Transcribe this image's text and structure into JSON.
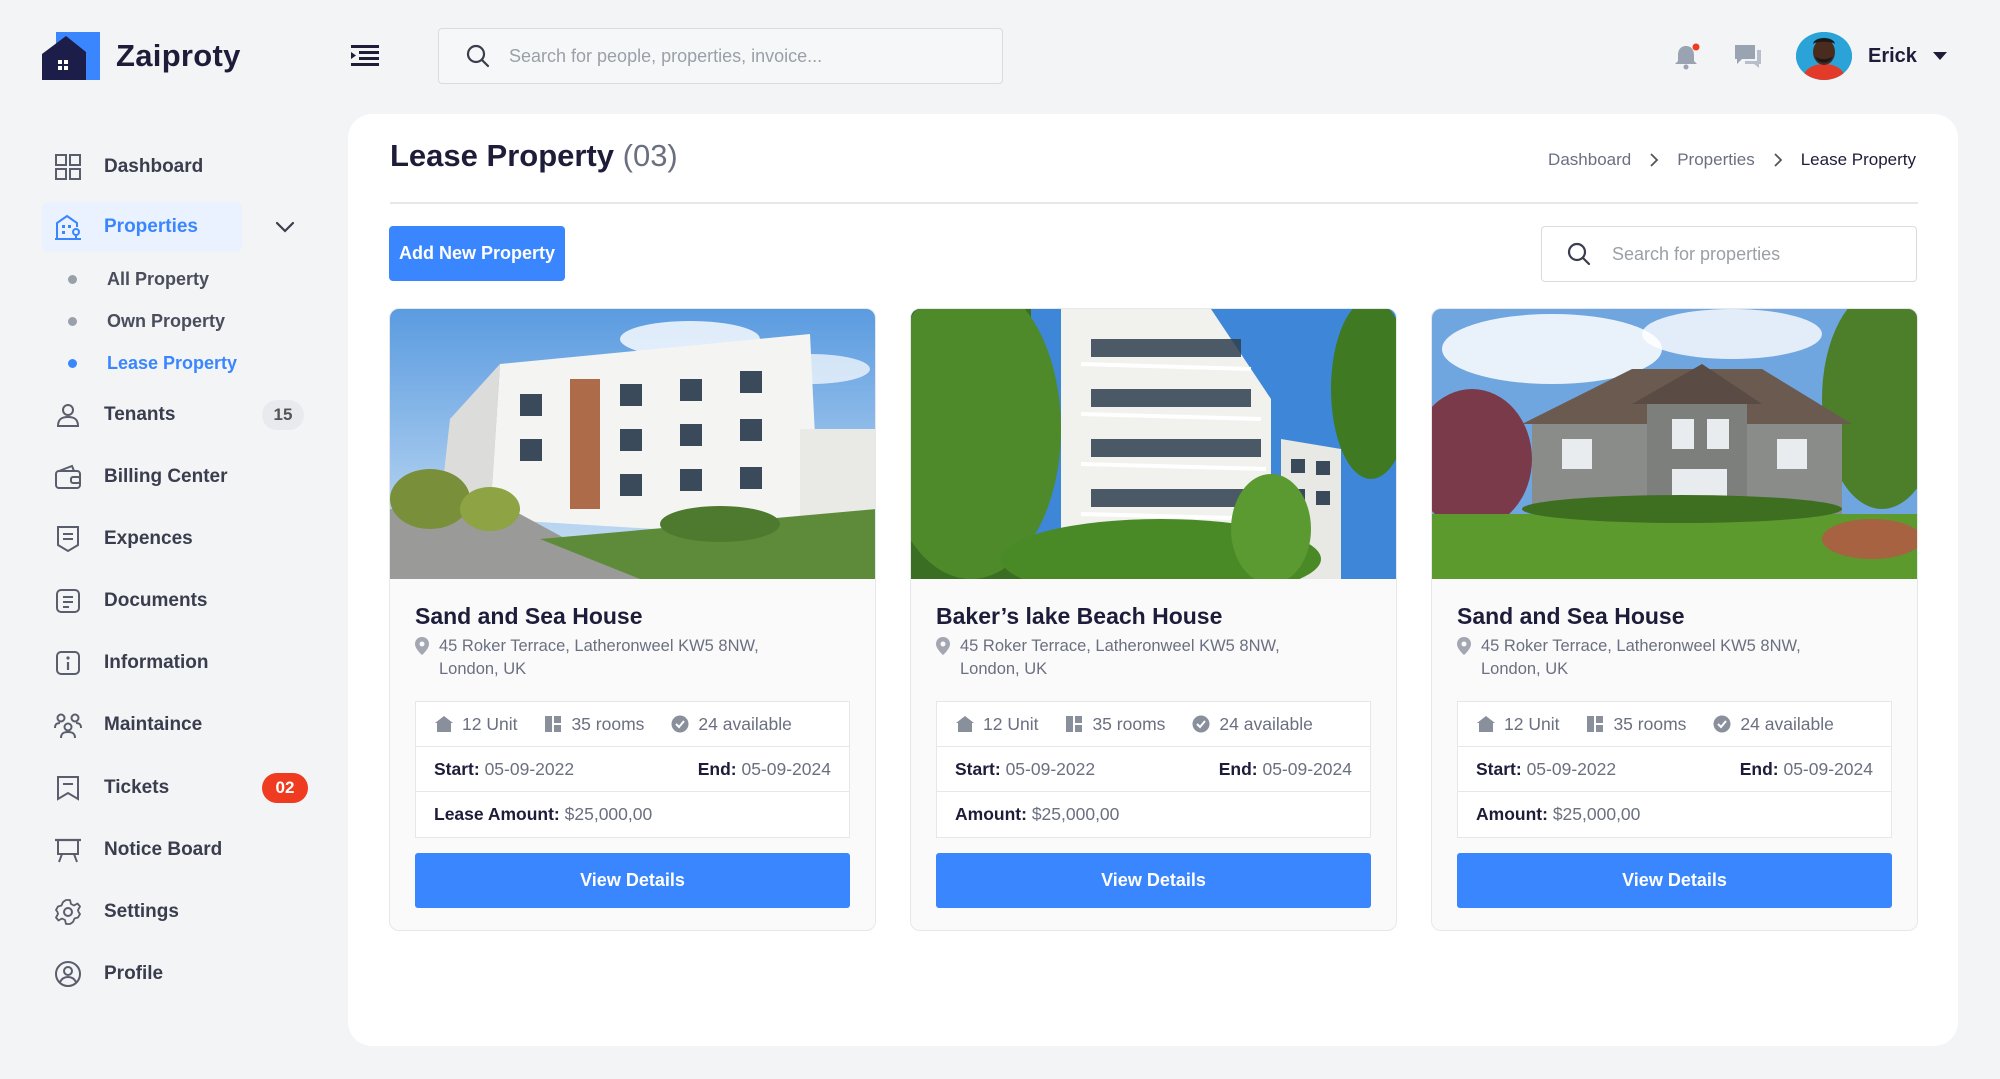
{
  "app": {
    "name": "Zaiproty"
  },
  "header": {
    "search_placeholder": "Search for people, properties, invoice...",
    "user_name": "Erick"
  },
  "sidebar": {
    "items": [
      {
        "label": "Dashboard"
      },
      {
        "label": "Properties"
      },
      {
        "label": "Tenants",
        "badge": "15"
      },
      {
        "label": "Billing Center"
      },
      {
        "label": "Expences"
      },
      {
        "label": "Documents"
      },
      {
        "label": "Information"
      },
      {
        "label": "Maintaince"
      },
      {
        "label": "Tickets",
        "badge": "02"
      },
      {
        "label": "Notice Board"
      },
      {
        "label": "Settings"
      },
      {
        "label": "Profile"
      }
    ],
    "properties_sub": [
      {
        "label": "All Property"
      },
      {
        "label": "Own Property"
      },
      {
        "label": "Lease Property"
      }
    ]
  },
  "page": {
    "title": "Lease Property",
    "count": "(03)",
    "breadcrumb": [
      "Dashboard",
      "Properties",
      "Lease Property"
    ],
    "add_button": "Add New Property",
    "search_placeholder": "Search for properties"
  },
  "cards": [
    {
      "title": "Sand and Sea House",
      "address": "45 Roker Terrace, Latheronweel KW5 8NW, London, UK",
      "units": "12 Unit",
      "rooms": "35 rooms",
      "available": "24 available",
      "start_label": "Start:",
      "start": "05-09-2022",
      "end_label": "End:",
      "end": "05-09-2024",
      "amount_label": "Lease Amount:",
      "amount": "$25,000,00",
      "button": "View Details"
    },
    {
      "title": "Baker’s lake Beach House",
      "address": "45 Roker Terrace, Latheronweel KW5 8NW, London, UK",
      "units": "12 Unit",
      "rooms": "35 rooms",
      "available": "24 available",
      "start_label": "Start:",
      "start": "05-09-2022",
      "end_label": "End:",
      "end": "05-09-2024",
      "amount_label": "Amount:",
      "amount": "$25,000,00",
      "button": "View Details"
    },
    {
      "title": "Sand and Sea House",
      "address": "45 Roker Terrace, Latheronweel KW5 8NW, London, UK",
      "units": "12 Unit",
      "rooms": "35 rooms",
      "available": "24 available",
      "start_label": "Start:",
      "start": "05-09-2022",
      "end_label": "End:",
      "end": "05-09-2024",
      "amount_label": "Amount:",
      "amount": "$25,000,00",
      "button": "View Details"
    }
  ],
  "colors": {
    "accent": "#3a86ff",
    "badge_red": "#ef3b1f",
    "text_dark": "#1d1d3a",
    "text_muted": "#6b7080"
  }
}
